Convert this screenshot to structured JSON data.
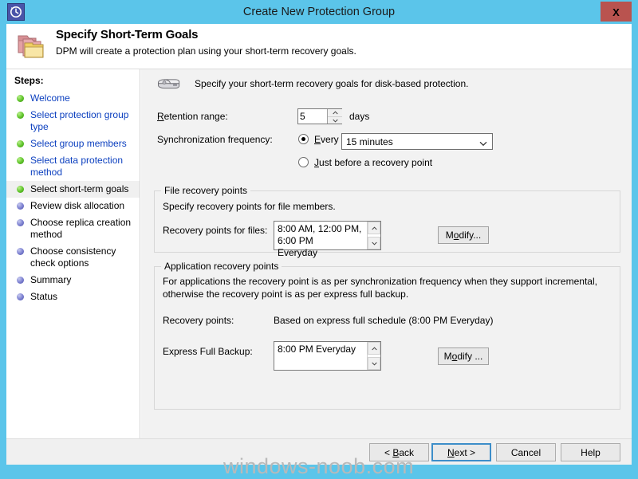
{
  "window": {
    "title": "Create New Protection Group",
    "icon": "clock-history-icon",
    "close_label": "X",
    "titlebar_color": "#5bc5ea",
    "close_color": "#b9534f"
  },
  "banner": {
    "icon": "folders-icon",
    "title": "Specify Short-Term Goals",
    "subtitle": "DPM will create a protection plan using your short-term recovery goals."
  },
  "sidebar": {
    "header": "Steps:",
    "items": [
      {
        "label": "Welcome",
        "state": "done",
        "bullet": "green"
      },
      {
        "label": "Select protection group type",
        "state": "done",
        "bullet": "green"
      },
      {
        "label": "Select group members",
        "state": "done",
        "bullet": "green"
      },
      {
        "label": "Select data protection method",
        "state": "done",
        "bullet": "green"
      },
      {
        "label": "Select short-term goals",
        "state": "current",
        "bullet": "green"
      },
      {
        "label": "Review disk allocation",
        "state": "future",
        "bullet": "blue"
      },
      {
        "label": "Choose replica creation method",
        "state": "future",
        "bullet": "blue"
      },
      {
        "label": "Choose consistency check options",
        "state": "future",
        "bullet": "blue"
      },
      {
        "label": "Summary",
        "state": "future",
        "bullet": "blue"
      },
      {
        "label": "Status",
        "state": "future",
        "bullet": "blue"
      }
    ]
  },
  "main": {
    "intro": {
      "icon": "disk-drive-icon",
      "text": "Specify your short-term recovery goals for disk-based protection."
    },
    "retention": {
      "label": "Retention range:",
      "value": "5",
      "unit": "days",
      "spinner_up": "spinner-up-icon",
      "spinner_down": "spinner-down-icon"
    },
    "sync": {
      "label": "Synchronization frequency:",
      "option_every": "Every",
      "option_every_selected": true,
      "frequency_value": "15 minutes",
      "option_just_before": "Just before a recovery point",
      "option_just_before_selected": false
    },
    "file_recovery": {
      "group_title": "File recovery points",
      "description": "Specify recovery points for file members.",
      "field_label": "Recovery points for files:",
      "value": "8:00 AM, 12:00 PM, 6:00 PM\nEveryday",
      "modify_label": "Modify..."
    },
    "app_recovery": {
      "group_title": "Application recovery points",
      "description": "For applications the recovery point is as per synchronization frequency when they support incremental, otherwise the recovery point is as per express full backup.",
      "recovery_points_label": "Recovery points:",
      "recovery_points_value": "Based on express full schedule (8:00 PM Everyday)",
      "express_label": "Express Full Backup:",
      "express_value": "8:00 PM Everyday",
      "modify_label": "Modify ..."
    }
  },
  "footer": {
    "back": "< Back",
    "next": "Next >",
    "cancel": "Cancel",
    "help": "Help"
  },
  "watermark": "windows-noob.com"
}
